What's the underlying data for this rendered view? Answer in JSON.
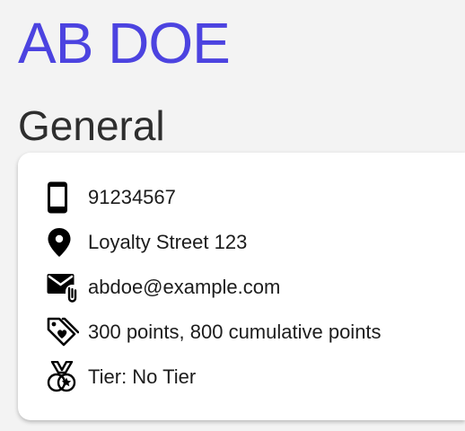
{
  "header": {
    "name": "AB DOE"
  },
  "section": {
    "title": "General"
  },
  "details": {
    "phone": {
      "icon": "mobile-phone-icon",
      "value": "91234567"
    },
    "address": {
      "icon": "map-pin-icon",
      "value": "Loyalty Street 123"
    },
    "email": {
      "icon": "mail-attachment-icon",
      "value": "abdoe@example.com"
    },
    "points": {
      "icon": "tags-heart-icon",
      "value": "300 points, 800 cumulative points"
    },
    "tier": {
      "icon": "medal-icon",
      "value": "Tier: No Tier"
    }
  },
  "colors": {
    "accent": "#4c43e0",
    "text": "#1c1c1c",
    "background": "#f3f3f3",
    "card": "#ffffff"
  }
}
